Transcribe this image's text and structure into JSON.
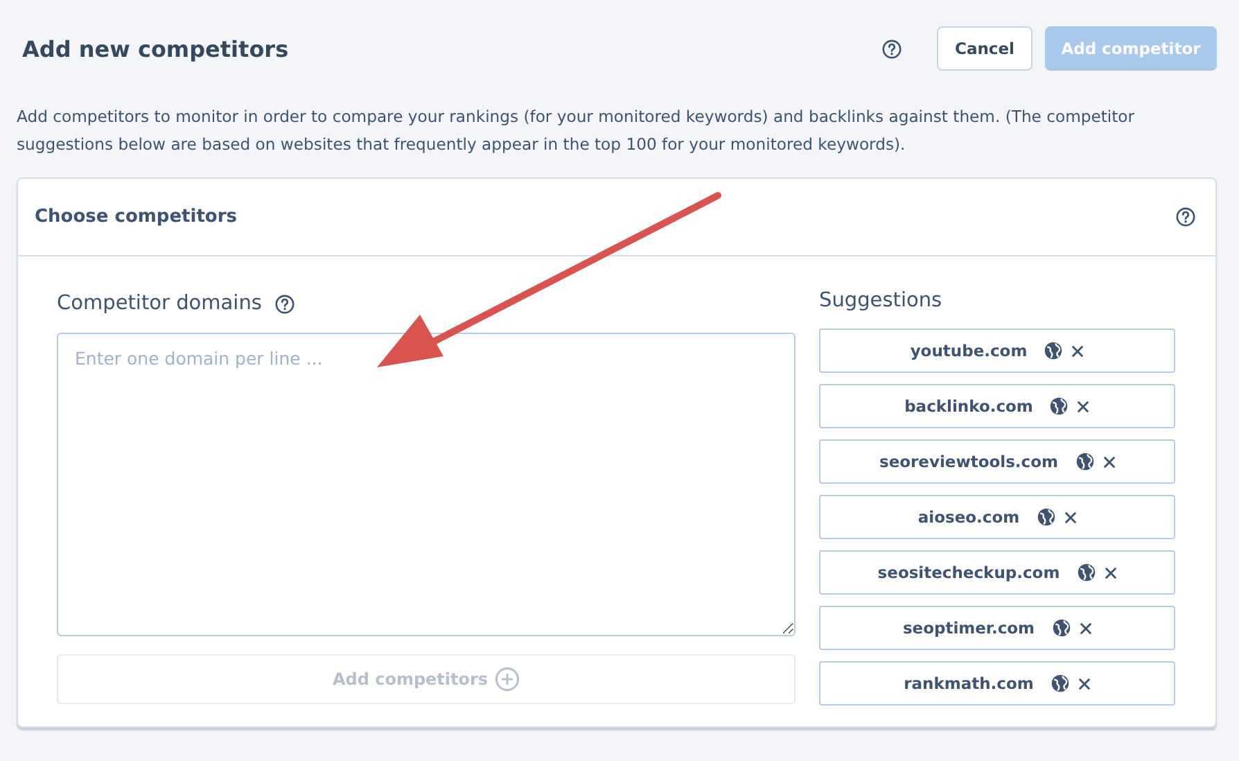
{
  "header": {
    "title": "Add new competitors",
    "buttons": [
      {
        "label": "Cancel",
        "kind": "secondary",
        "disabled": false
      },
      {
        "label": "Add competitor",
        "kind": "primary",
        "disabled": true
      }
    ]
  },
  "description": "Add competitors to monitor in order to compare your rankings (for your monitored keywords) and backlinks against them. (The competitor suggestions below are based on websites that frequently appear in the top 100 for your monitored keywords).",
  "card": {
    "title": "Choose competitors",
    "domains": {
      "label": "Competitor domains",
      "placeholder": "Enter one domain per line ...",
      "button": {
        "label": "Add competitors",
        "disabled": true
      }
    },
    "suggestions": {
      "title": "Suggestions",
      "items": [
        {
          "domain": "youtube.com"
        },
        {
          "domain": "backlinko.com"
        },
        {
          "domain": "seoreviewtools.com"
        },
        {
          "domain": "aioseo.com"
        },
        {
          "domain": "seositecheckup.com"
        },
        {
          "domain": "seoptimer.com"
        },
        {
          "domain": "rankmath.com"
        }
      ]
    }
  }
}
